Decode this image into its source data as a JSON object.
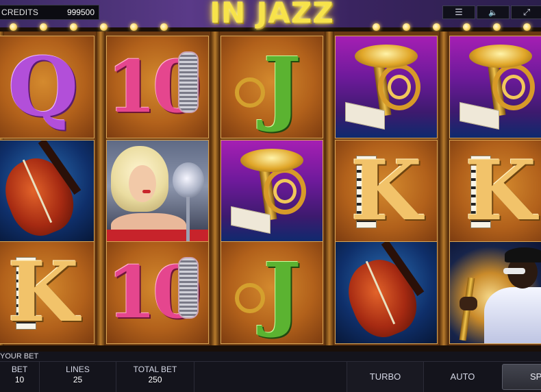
{
  "credits": {
    "label": "CREDITS",
    "value": "999500"
  },
  "title": "IN JAZZ",
  "top_buttons": [
    {
      "name": "menu-icon",
      "glyph": "☰"
    },
    {
      "name": "speaker-icon",
      "glyph": "🔈"
    },
    {
      "name": "fullscreen-icon",
      "glyph": "⤢"
    }
  ],
  "reels": [
    [
      "Q",
      "cello",
      "K"
    ],
    [
      "10",
      "singer",
      "10"
    ],
    [
      "J",
      "horn",
      "J"
    ],
    [
      "horn",
      "K",
      "cello"
    ],
    [
      "horn",
      "K",
      "sax-player"
    ]
  ],
  "bottom": {
    "your_bet_label": "YOUR BET",
    "bet_label": "BET",
    "bet_value": "10",
    "lines_label": "LINES",
    "lines_value": "25",
    "total_bet_label": "TOTAL BET",
    "total_bet_value": "250",
    "turbo_label": "TURBO",
    "auto_label": "AUTO",
    "spin_label": "SPIN"
  }
}
